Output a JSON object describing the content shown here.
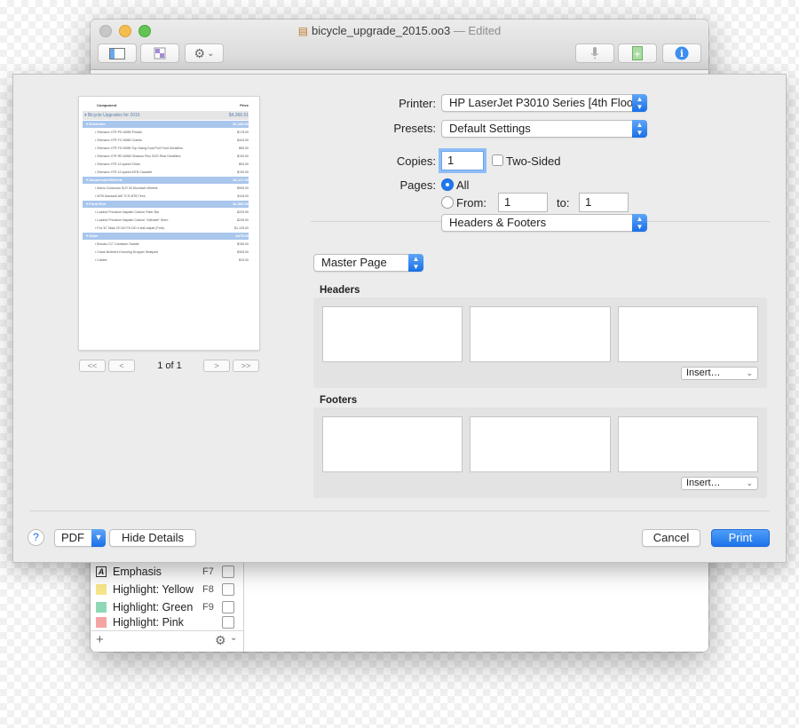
{
  "window": {
    "title": "bicycle_upgrade_2015.oo3",
    "status": "— Edited"
  },
  "toolbar": {
    "gear_caret": "⌄"
  },
  "styles_panel": {
    "items": [
      {
        "label": "Emphasis",
        "key": "F7",
        "swatch": "#ffffff",
        "swatch_text": "A"
      },
      {
        "label": "Highlight: Yellow",
        "key": "F8",
        "swatch": "#f7e58a",
        "swatch_text": ""
      },
      {
        "label": "Highlight: Green",
        "key": "F9",
        "swatch": "#8fd8b6",
        "swatch_text": ""
      },
      {
        "label": "Highlight: Pink",
        "key": "",
        "swatch": "#f5a3a3",
        "swatch_text": ""
      }
    ],
    "add_label": "+"
  },
  "preview": {
    "header": {
      "col1": "Component",
      "col2": "Price"
    },
    "rows": [
      {
        "text": "▾ Bicycle Upgrades for 2015",
        "price": "$4,366.91",
        "kind": "total"
      },
      {
        "text": "▾ Drivetrain",
        "price": "$1,168.00",
        "kind": "cat"
      },
      {
        "text": "• Shimano XTR PD-M980 Pedals",
        "price": "$178.00",
        "kind": "item"
      },
      {
        "text": "• Shimano XTR FC-M980 Cranks",
        "price": "$444.00",
        "kind": "item"
      },
      {
        "text": "• Shimano XTR FD-M980 Top Swing Dual Pull Front Derailleur",
        "price": "$85.00",
        "kind": "item"
      },
      {
        "text": "• Shimano XTR RD-M980 Shadow Plus SGS Rear Derailleur",
        "price": "$199.00",
        "kind": "item"
      },
      {
        "text": "• Shimano XTR 10-speed Chain",
        "price": "$54.00",
        "kind": "item"
      },
      {
        "text": "• Shimano XTR 10-speed MTB Cassette",
        "price": "$199.00",
        "kind": "item"
      },
      {
        "text": "▾ Suspension/Wheels",
        "price": "$1,117.00",
        "kind": "cat"
      },
      {
        "text": "• Mavic Crossmax SLR 26 Mountain Wheels",
        "price": "$999.00",
        "kind": "item"
      },
      {
        "text": "• MTB Maxxsell AM TCS MTB Tires",
        "price": "$118.00",
        "kind": "item"
      },
      {
        "text": "▾ Front End",
        "price": "$1,596.90",
        "kind": "cat"
      },
      {
        "text": "• Loaded Precision Napalm Carbon Riser Bar",
        "price": "$229.90",
        "kind": "item"
      },
      {
        "text": "• Loaded Precision Napalm Carbon \"Ultimate\" Stem",
        "price": "$249.00",
        "kind": "item"
      },
      {
        "text": "• Fox 32 Talas 29 140 Fit CtD e-trail adjust (Fork)",
        "price": "$1,125.00",
        "kind": "item"
      },
      {
        "text": "▾ Other",
        "price": "$475.00",
        "kind": "cat"
      },
      {
        "text": "• Brooks C17 Cambium Saddle",
        "price": "$155.00",
        "kind": "item"
      },
      {
        "text": "• Crank Brothers Kronolog Dropper Seatpost",
        "price": "$305.00",
        "kind": "item"
      },
      {
        "text": "• Cables",
        "price": "$15.00",
        "kind": "item"
      }
    ]
  },
  "pager": {
    "first": "<<",
    "prev": "<",
    "next": ">",
    "last": ">>",
    "text": "1 of 1"
  },
  "print": {
    "printer_label": "Printer:",
    "printer_value": "HP LaserJet P3010 Series [4th Floor]",
    "presets_label": "Presets:",
    "presets_value": "Default Settings",
    "copies_label": "Copies:",
    "copies_value": "1",
    "two_sided_label": "Two-Sided",
    "pages_label": "Pages:",
    "all_label": "All",
    "from_label": "From:",
    "from_value": "1",
    "to_label": "to:",
    "to_value": "1",
    "section_value": "Headers & Footers",
    "master_value": "Master Page",
    "headers_title": "Headers",
    "footers_title": "Footers",
    "insert_label": "Insert…"
  },
  "footer": {
    "help": "?",
    "pdf": "PDF",
    "hide_details": "Hide Details",
    "cancel": "Cancel",
    "print": "Print"
  }
}
